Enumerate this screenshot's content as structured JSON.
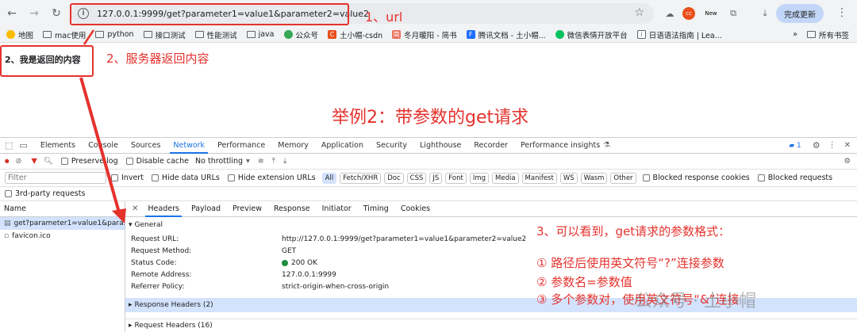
{
  "browser": {
    "url": "127.0.0.1:9999/get?parameter1=value1&parameter2=value2",
    "update_label": "完成更新",
    "bookmarks": [
      "地图",
      "mac使用",
      "python",
      "接口测试",
      "性能测试",
      "java",
      "公众号",
      "土小帽-csdn",
      "冬月暖阳 - 简书",
      "腾讯文档 - 土小帽...",
      "微信表情开放平台",
      "日语语法指南 | Lea..."
    ],
    "all_bookmarks_label": "所有书签"
  },
  "page": {
    "content": "2、我是返回的内容"
  },
  "annotations": {
    "url_note": "1、url",
    "server_note": "2、服务器返回内容",
    "example_title": "举例2：带参数的get请求",
    "format_title": "3、可以看到，get请求的参数格式：",
    "format_items": [
      "① 路径后使用英文符号“?”连接参数",
      "② 参数名=参数值",
      "③ 多个参数对，使用英文符号“&”连接"
    ],
    "watermark": "公众号 · 土小帽"
  },
  "devtools": {
    "tabs": [
      "Elements",
      "Console",
      "Sources",
      "Network",
      "Performance",
      "Memory",
      "Application",
      "Security",
      "Lighthouse",
      "Recorder",
      "Performance insights"
    ],
    "active_tab": "Network",
    "issues_count": "1",
    "toolbar": {
      "preserve_log": "Preserve log",
      "disable_cache": "Disable cache",
      "throttling": "No throttling"
    },
    "filter": {
      "placeholder": "Filter",
      "invert": "Invert",
      "hide_data_urls": "Hide data URLs",
      "hide_extension_urls": "Hide extension URLs",
      "types": [
        "All",
        "Fetch/XHR",
        "Doc",
        "CSS",
        "JS",
        "Font",
        "Img",
        "Media",
        "Manifest",
        "WS",
        "Wasm",
        "Other"
      ],
      "blocked_cookies": "Blocked response cookies",
      "blocked_requests": "Blocked requests",
      "third_party": "3rd-party requests"
    },
    "requests_header": "Name",
    "requests": [
      "get?parameter1=value1&para...",
      "favicon.ico"
    ],
    "detail_tabs": [
      "Headers",
      "Payload",
      "Preview",
      "Response",
      "Initiator",
      "Timing",
      "Cookies"
    ],
    "active_detail_tab": "Headers",
    "general_label": "General",
    "general": [
      {
        "k": "Request URL:",
        "v": "http://127.0.0.1:9999/get?parameter1=value1&parameter2=value2"
      },
      {
        "k": "Request Method:",
        "v": "GET"
      },
      {
        "k": "Status Code:",
        "v": "200 OK"
      },
      {
        "k": "Remote Address:",
        "v": "127.0.0.1:9999"
      },
      {
        "k": "Referrer Policy:",
        "v": "strict-origin-when-cross-origin"
      }
    ],
    "response_headers": "Response Headers (2)",
    "request_headers": "Request Headers (16)"
  },
  "colors": {
    "annotation": "#e5322d",
    "accent": "#1a73e8",
    "status_ok": "#1e8e3e"
  }
}
